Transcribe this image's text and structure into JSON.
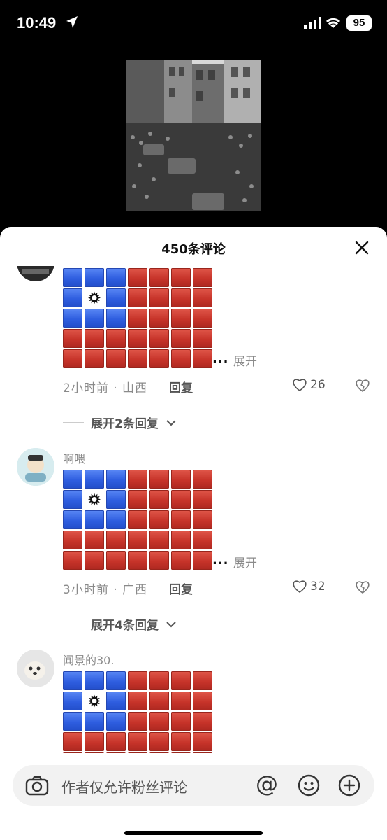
{
  "status_bar": {
    "time": "10:49",
    "battery": "95"
  },
  "sheet": {
    "title": "450条评论"
  },
  "comments": [
    {
      "username": "",
      "expand": "展开",
      "meta": "2小时前 · 山西",
      "reply": "回复",
      "likes": "26",
      "more_replies": "展开2条回复"
    },
    {
      "username": "啊喂",
      "expand": "展开",
      "meta": "3小时前 · 广西",
      "reply": "回复",
      "likes": "32",
      "more_replies": "展开4条回复"
    },
    {
      "username": "闻景的30.",
      "expand": "",
      "meta": "",
      "reply": "",
      "likes": "",
      "more_replies": ""
    }
  ],
  "input_bar": {
    "placeholder": "作者仅允许粉丝评论",
    "at": "@"
  },
  "colors": {
    "flag_blue": "#2f5ee0",
    "flag_red": "#c7342a",
    "sheet_bg": "#ffffff",
    "screen_bg": "#000000"
  },
  "icons": [
    "location-arrow-icon",
    "signal-icon",
    "wifi-icon",
    "close-icon",
    "heart-icon",
    "broken-heart-icon",
    "chevron-down-icon",
    "camera-icon",
    "emoji-icon",
    "plus-icon"
  ]
}
